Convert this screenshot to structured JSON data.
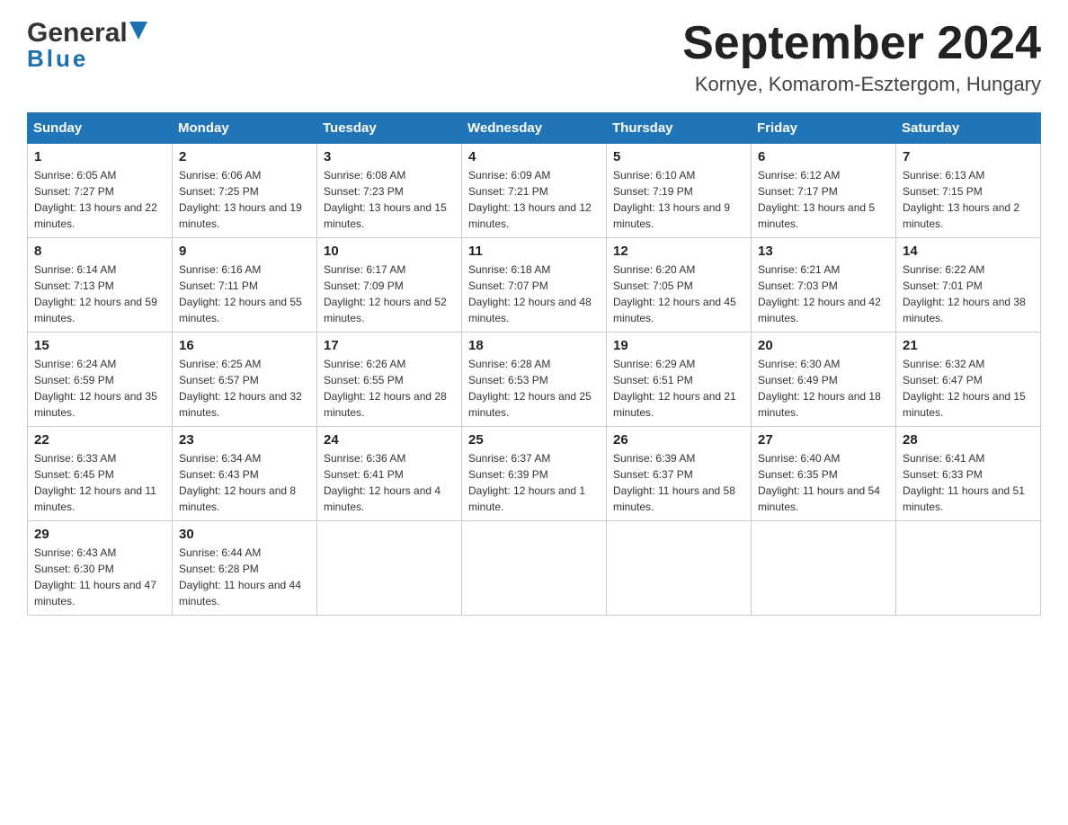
{
  "header": {
    "logo_general": "General",
    "logo_blue": "Blue",
    "title": "September 2024",
    "subtitle": "Kornye, Komarom-Esztergom, Hungary"
  },
  "days_of_week": [
    "Sunday",
    "Monday",
    "Tuesday",
    "Wednesday",
    "Thursday",
    "Friday",
    "Saturday"
  ],
  "weeks": [
    [
      {
        "day": "1",
        "sunrise": "6:05 AM",
        "sunset": "7:27 PM",
        "daylight": "13 hours and 22 minutes."
      },
      {
        "day": "2",
        "sunrise": "6:06 AM",
        "sunset": "7:25 PM",
        "daylight": "13 hours and 19 minutes."
      },
      {
        "day": "3",
        "sunrise": "6:08 AM",
        "sunset": "7:23 PM",
        "daylight": "13 hours and 15 minutes."
      },
      {
        "day": "4",
        "sunrise": "6:09 AM",
        "sunset": "7:21 PM",
        "daylight": "13 hours and 12 minutes."
      },
      {
        "day": "5",
        "sunrise": "6:10 AM",
        "sunset": "7:19 PM",
        "daylight": "13 hours and 9 minutes."
      },
      {
        "day": "6",
        "sunrise": "6:12 AM",
        "sunset": "7:17 PM",
        "daylight": "13 hours and 5 minutes."
      },
      {
        "day": "7",
        "sunrise": "6:13 AM",
        "sunset": "7:15 PM",
        "daylight": "13 hours and 2 minutes."
      }
    ],
    [
      {
        "day": "8",
        "sunrise": "6:14 AM",
        "sunset": "7:13 PM",
        "daylight": "12 hours and 59 minutes."
      },
      {
        "day": "9",
        "sunrise": "6:16 AM",
        "sunset": "7:11 PM",
        "daylight": "12 hours and 55 minutes."
      },
      {
        "day": "10",
        "sunrise": "6:17 AM",
        "sunset": "7:09 PM",
        "daylight": "12 hours and 52 minutes."
      },
      {
        "day": "11",
        "sunrise": "6:18 AM",
        "sunset": "7:07 PM",
        "daylight": "12 hours and 48 minutes."
      },
      {
        "day": "12",
        "sunrise": "6:20 AM",
        "sunset": "7:05 PM",
        "daylight": "12 hours and 45 minutes."
      },
      {
        "day": "13",
        "sunrise": "6:21 AM",
        "sunset": "7:03 PM",
        "daylight": "12 hours and 42 minutes."
      },
      {
        "day": "14",
        "sunrise": "6:22 AM",
        "sunset": "7:01 PM",
        "daylight": "12 hours and 38 minutes."
      }
    ],
    [
      {
        "day": "15",
        "sunrise": "6:24 AM",
        "sunset": "6:59 PM",
        "daylight": "12 hours and 35 minutes."
      },
      {
        "day": "16",
        "sunrise": "6:25 AM",
        "sunset": "6:57 PM",
        "daylight": "12 hours and 32 minutes."
      },
      {
        "day": "17",
        "sunrise": "6:26 AM",
        "sunset": "6:55 PM",
        "daylight": "12 hours and 28 minutes."
      },
      {
        "day": "18",
        "sunrise": "6:28 AM",
        "sunset": "6:53 PM",
        "daylight": "12 hours and 25 minutes."
      },
      {
        "day": "19",
        "sunrise": "6:29 AM",
        "sunset": "6:51 PM",
        "daylight": "12 hours and 21 minutes."
      },
      {
        "day": "20",
        "sunrise": "6:30 AM",
        "sunset": "6:49 PM",
        "daylight": "12 hours and 18 minutes."
      },
      {
        "day": "21",
        "sunrise": "6:32 AM",
        "sunset": "6:47 PM",
        "daylight": "12 hours and 15 minutes."
      }
    ],
    [
      {
        "day": "22",
        "sunrise": "6:33 AM",
        "sunset": "6:45 PM",
        "daylight": "12 hours and 11 minutes."
      },
      {
        "day": "23",
        "sunrise": "6:34 AM",
        "sunset": "6:43 PM",
        "daylight": "12 hours and 8 minutes."
      },
      {
        "day": "24",
        "sunrise": "6:36 AM",
        "sunset": "6:41 PM",
        "daylight": "12 hours and 4 minutes."
      },
      {
        "day": "25",
        "sunrise": "6:37 AM",
        "sunset": "6:39 PM",
        "daylight": "12 hours and 1 minute."
      },
      {
        "day": "26",
        "sunrise": "6:39 AM",
        "sunset": "6:37 PM",
        "daylight": "11 hours and 58 minutes."
      },
      {
        "day": "27",
        "sunrise": "6:40 AM",
        "sunset": "6:35 PM",
        "daylight": "11 hours and 54 minutes."
      },
      {
        "day": "28",
        "sunrise": "6:41 AM",
        "sunset": "6:33 PM",
        "daylight": "11 hours and 51 minutes."
      }
    ],
    [
      {
        "day": "29",
        "sunrise": "6:43 AM",
        "sunset": "6:30 PM",
        "daylight": "11 hours and 47 minutes."
      },
      {
        "day": "30",
        "sunrise": "6:44 AM",
        "sunset": "6:28 PM",
        "daylight": "11 hours and 44 minutes."
      },
      null,
      null,
      null,
      null,
      null
    ]
  ]
}
